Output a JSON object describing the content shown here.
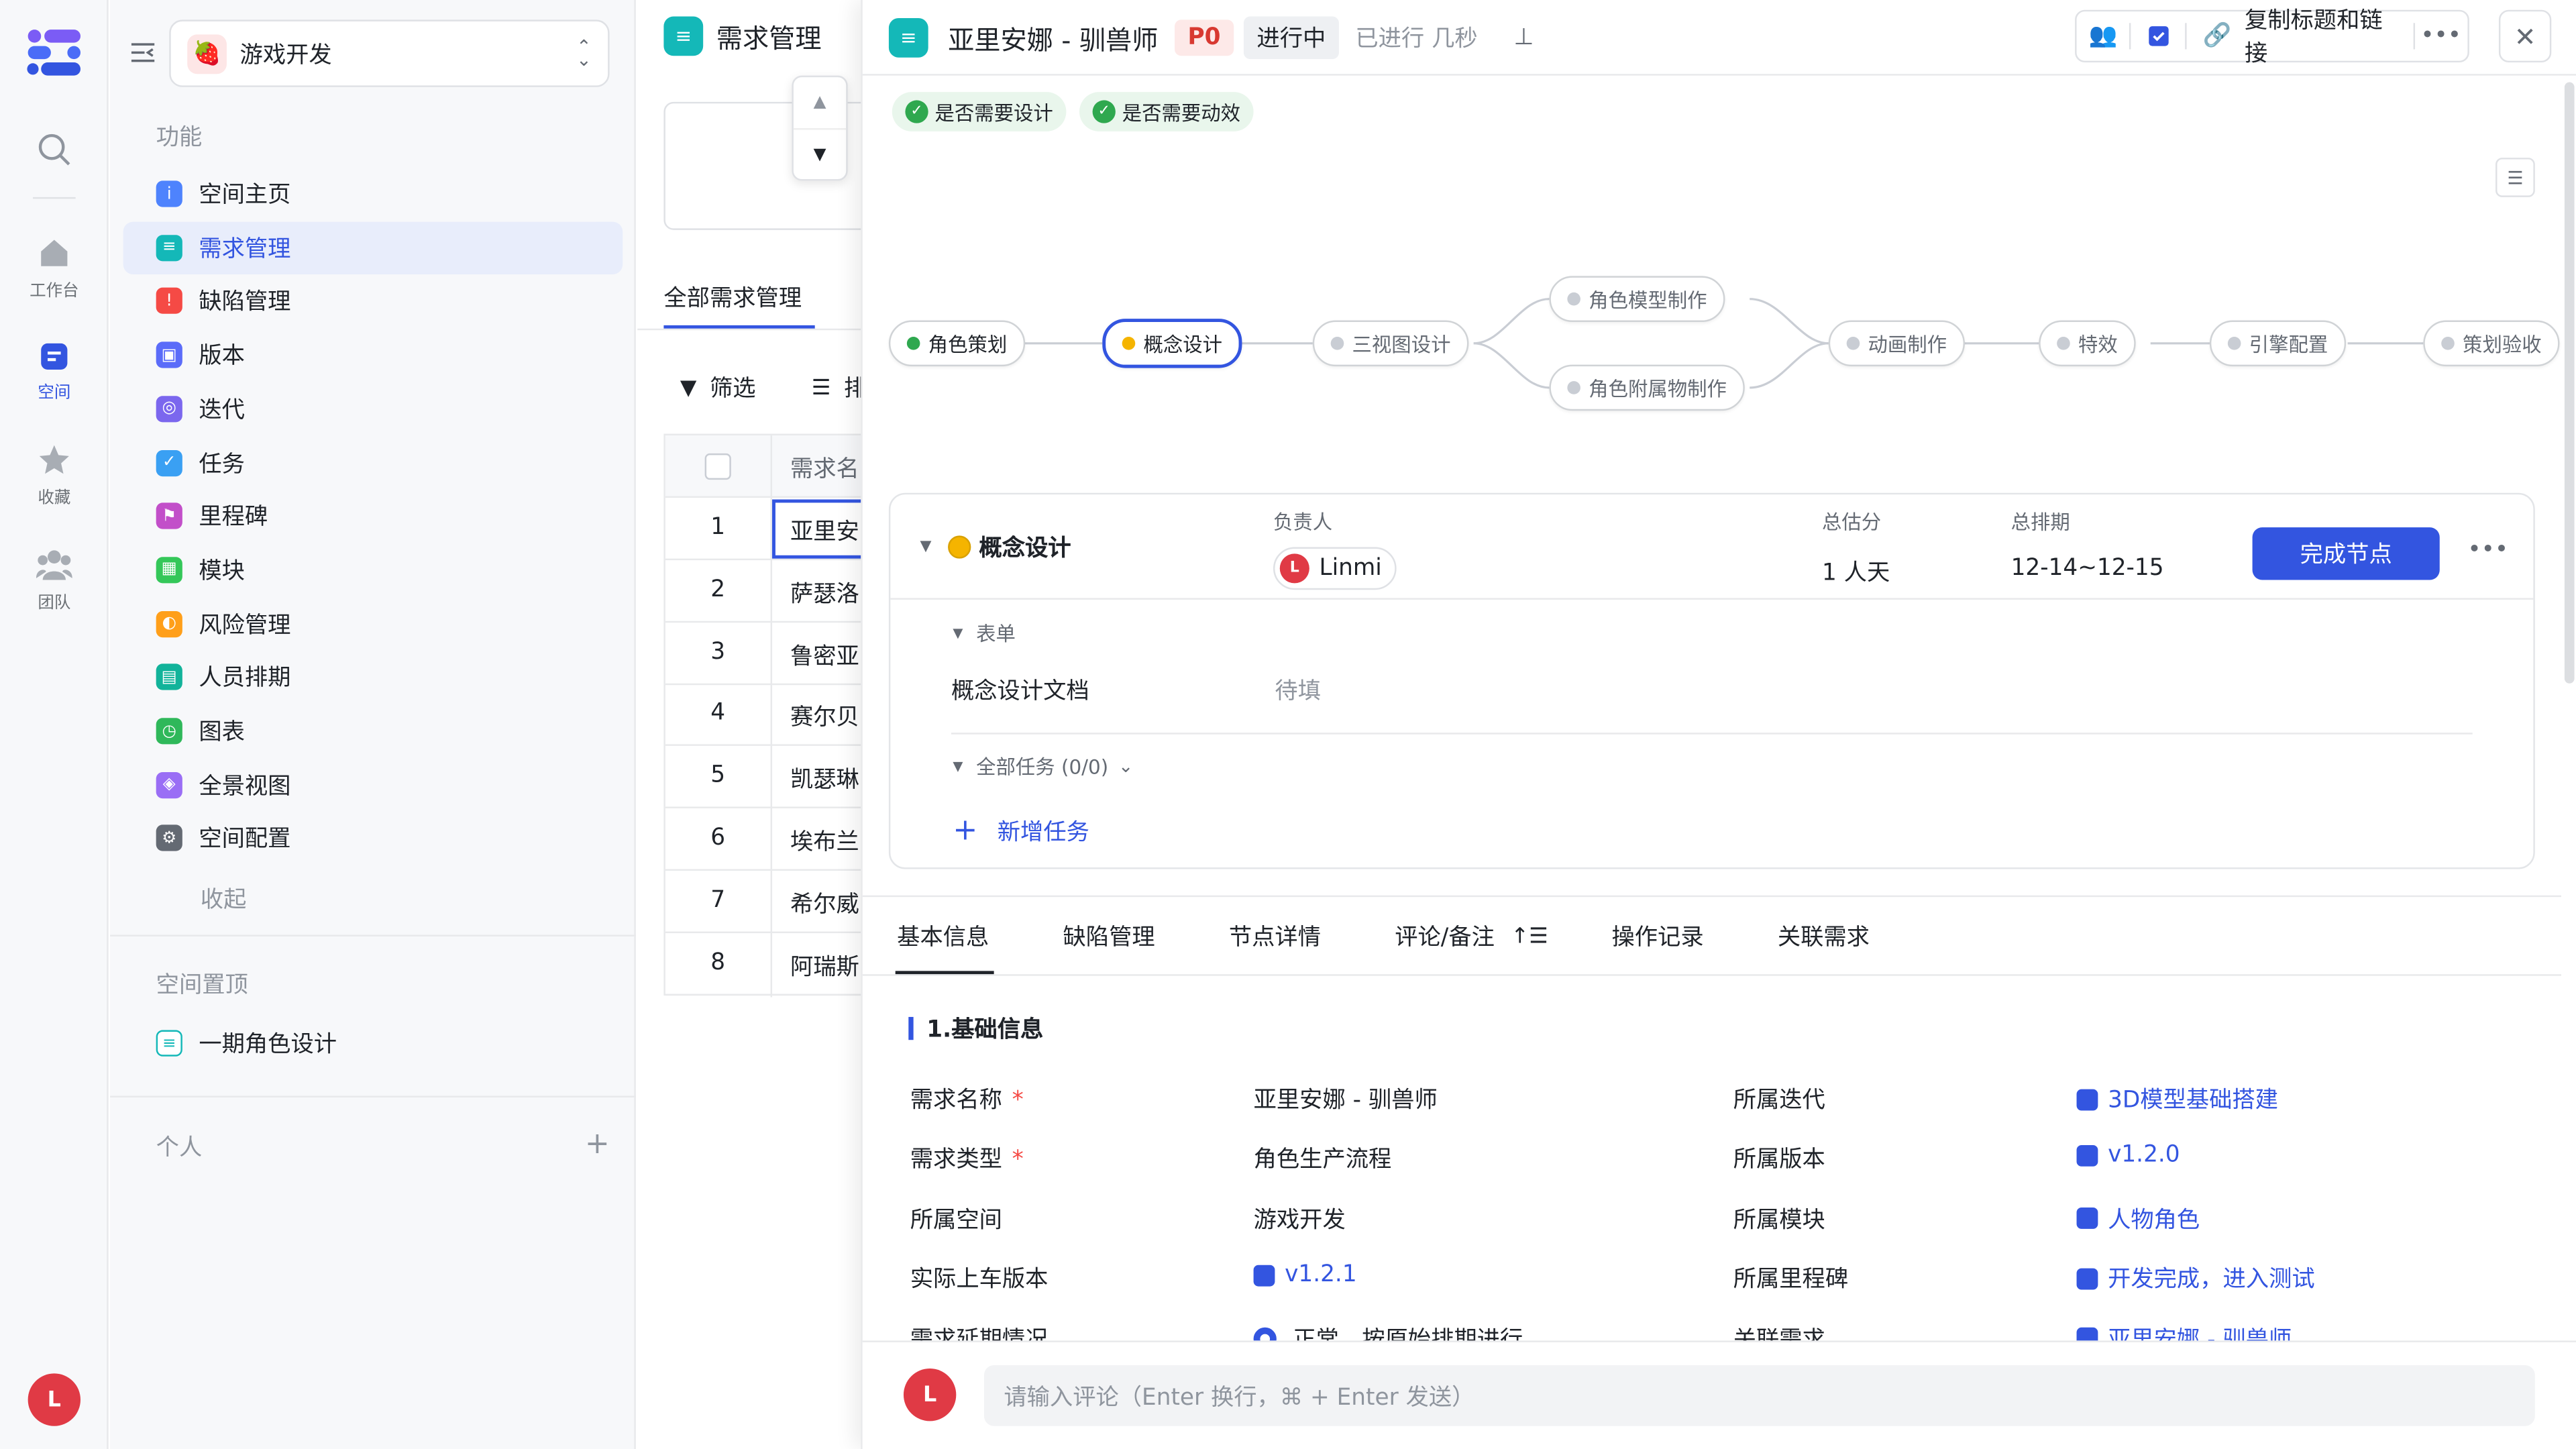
{
  "rail": {
    "items": [
      {
        "label": "工作台"
      },
      {
        "label": "空间"
      },
      {
        "label": "收藏"
      },
      {
        "label": "团队"
      }
    ],
    "avatar": "L"
  },
  "sidebar": {
    "project": "游戏开发",
    "section_func": "功能",
    "items": [
      {
        "label": "空间主页",
        "color": "#4e83fd"
      },
      {
        "label": "需求管理",
        "color": "#14b8b8"
      },
      {
        "label": "缺陷管理",
        "color": "#f54a45"
      },
      {
        "label": "版本",
        "color": "#5b6cf9"
      },
      {
        "label": "迭代",
        "color": "#7b67ee"
      },
      {
        "label": "任务",
        "color": "#3aa0f3"
      },
      {
        "label": "里程碑",
        "color": "#c24fc9"
      },
      {
        "label": "模块",
        "color": "#34c759"
      },
      {
        "label": "风险管理",
        "color": "#ff9f1a"
      },
      {
        "label": "人员排期",
        "color": "#12b39a"
      },
      {
        "label": "图表",
        "color": "#2fb85a"
      },
      {
        "label": "全景视图",
        "color": "#9a6ef5"
      },
      {
        "label": "空间配置",
        "color": "#646a73"
      }
    ],
    "collapse": "收起",
    "section_pinned": "空间置顶",
    "pinned_item": "一期角色设计",
    "section_personal": "个人"
  },
  "middle": {
    "title": "需求管理",
    "tab_all": "全部需求管理",
    "filter": "筛选",
    "sort_partial": "排",
    "col_name": "需求名",
    "rows": [
      {
        "num": "1",
        "name": "亚里安"
      },
      {
        "num": "2",
        "name": "萨瑟洛"
      },
      {
        "num": "3",
        "name": "鲁密亚"
      },
      {
        "num": "4",
        "name": "赛尔贝"
      },
      {
        "num": "5",
        "name": "凯瑟琳"
      },
      {
        "num": "6",
        "name": "埃布兰"
      },
      {
        "num": "7",
        "name": "希尔威"
      },
      {
        "num": "8",
        "name": "阿瑞斯"
      }
    ]
  },
  "panel": {
    "title": "亚里安娜 - 驯兽师",
    "priority": "P0",
    "status": "进行中",
    "elapsed": "已进行 几秒",
    "copy_link": "复制标题和链接",
    "tags": [
      "是否需要设计",
      "是否需要动效"
    ],
    "workflow": {
      "nodes": [
        "角色策划",
        "概念设计",
        "三视图设计",
        "角色模型制作",
        "角色附属物制作",
        "动画制作",
        "特效",
        "引擎配置",
        "策划验收"
      ]
    },
    "node_card": {
      "name": "概念设计",
      "owner_label": "负责人",
      "owner": "Linmi",
      "owner_avatar": "L",
      "estimate_label": "总估分",
      "estimate": "1 人天",
      "schedule_label": "总排期",
      "schedule": "12-14~12-15",
      "complete_btn": "完成节点",
      "form_label": "表单",
      "form_field": "概念设计文档",
      "form_value": "待填",
      "tasks_label": "全部任务 (0/0)",
      "add_task": "新增任务"
    },
    "tabs": [
      "基本信息",
      "缺陷管理",
      "节点详情",
      "评论/备注",
      "操作记录",
      "关联需求"
    ],
    "basic": {
      "section_title": "1.基础信息",
      "left": [
        {
          "label": "需求名称",
          "required": true,
          "value": "亚里安娜 - 驯兽师"
        },
        {
          "label": "需求类型",
          "required": true,
          "value": "角色生产流程"
        },
        {
          "label": "所属空间",
          "required": false,
          "value": "游戏开发"
        },
        {
          "label": "实际上车版本",
          "required": false,
          "value": "v1.2.1",
          "link": true
        },
        {
          "label": "需求延期情况",
          "required": false,
          "value": "正常，按原始排期进行"
        }
      ],
      "right": [
        {
          "label": "所属迭代",
          "value": "3D模型基础搭建"
        },
        {
          "label": "所属版本",
          "value": "v1.2.0"
        },
        {
          "label": "所属模块",
          "value": "人物角色"
        },
        {
          "label": "所属里程碑",
          "value": "开发完成，进入测试"
        },
        {
          "label": "关联需求",
          "value": "亚里安娜 - 驯兽师"
        }
      ]
    },
    "comment": {
      "avatar": "L",
      "placeholder": "请输入评论（Enter 换行，⌘ + Enter 发送）"
    }
  }
}
